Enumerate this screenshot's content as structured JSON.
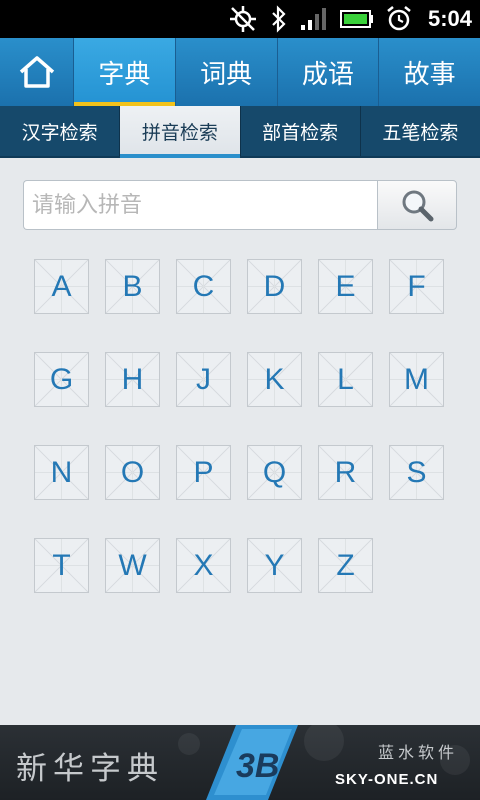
{
  "status_bar": {
    "time": "5:04"
  },
  "main_nav": {
    "tabs": [
      {
        "label": "字典",
        "active": true
      },
      {
        "label": "词典",
        "active": false
      },
      {
        "label": "成语",
        "active": false
      },
      {
        "label": "故事",
        "active": false
      }
    ]
  },
  "sub_nav": {
    "tabs": [
      {
        "label": "汉字检索",
        "active": false
      },
      {
        "label": "拼音检索",
        "active": true
      },
      {
        "label": "部首检索",
        "active": false
      },
      {
        "label": "五笔检索",
        "active": false
      }
    ]
  },
  "search": {
    "placeholder": "请输入拼音",
    "value": ""
  },
  "letters": [
    "A",
    "B",
    "C",
    "D",
    "E",
    "F",
    "G",
    "H",
    "J",
    "K",
    "L",
    "M",
    "N",
    "O",
    "P",
    "Q",
    "R",
    "S",
    "T",
    "W",
    "X",
    "Y",
    "Z"
  ],
  "footer": {
    "title": "新华字典",
    "company": "蓝水软件",
    "site": "SKY-ONE.CN"
  },
  "colors": {
    "accent": "#2a8fcb",
    "active_underline": "#f2c21b",
    "letter_text": "#2478b5"
  }
}
